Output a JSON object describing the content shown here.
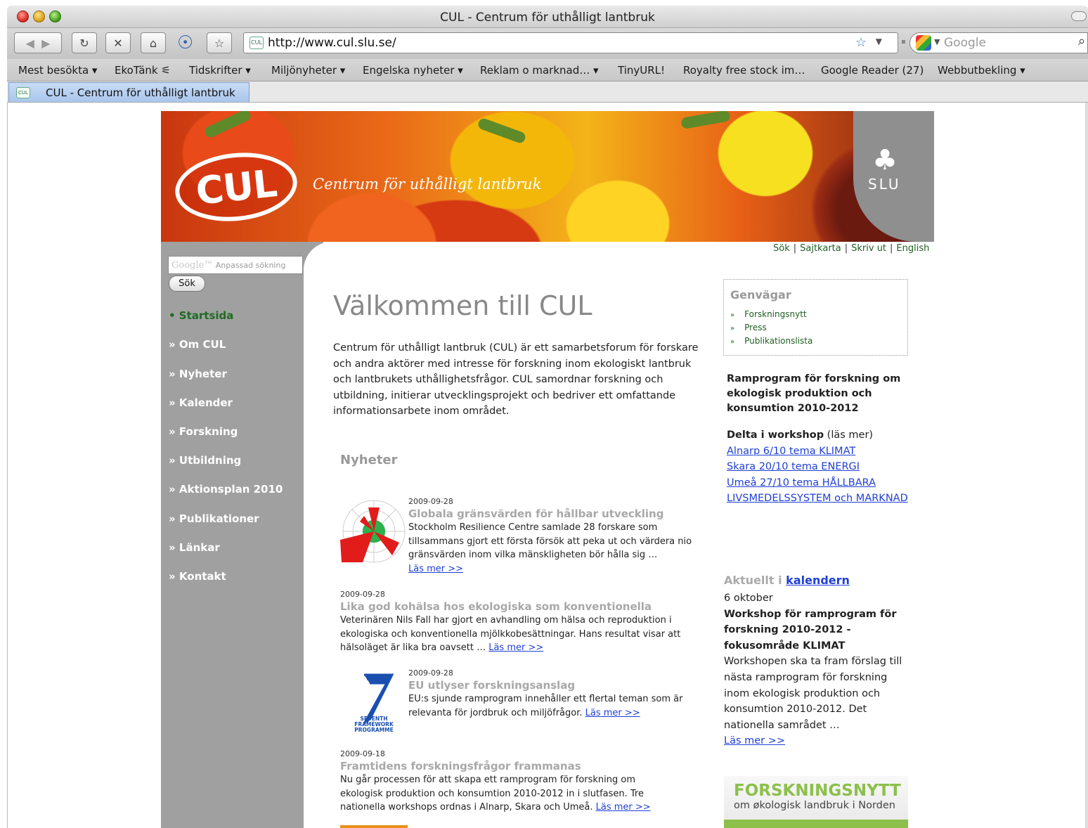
{
  "browser": {
    "window_title": "CUL - Centrum för uthålligt lantbruk",
    "url": "http://www.cul.slu.se/",
    "search_placeholder": "Google",
    "favicon_text": "CUL",
    "bookmarks": [
      "Mest besökta ▾",
      "EkoTänk ⚟",
      "Tidskrifter ▾",
      "Miljönyheter ▾",
      "Engelska nyheter ▾",
      "Reklam o marknad… ▾",
      "TinyURL!",
      "Royalty free stock im…",
      "Google Reader (27)",
      "Webbutbekling ▾"
    ],
    "tab_label": "CUL - Centrum för uthålligt lantbruk"
  },
  "banner": {
    "logo_text": "CUL",
    "tagline": "Centrum för uthålligt lantbruk",
    "slu_text": "SLU"
  },
  "toplinks": [
    "Sök",
    "Sajtkarta",
    "Skriv ut",
    "English"
  ],
  "sidebar": {
    "search_placeholder_brand": "Google™",
    "search_placeholder": "Anpassad sökning",
    "search_button": "Sök",
    "nav": [
      "• Startsida",
      "» Om CUL",
      "» Nyheter",
      "» Kalender",
      "» Forskning",
      "» Utbildning",
      "» Aktionsplan 2010",
      "» Publikationer",
      "» Länkar",
      "» Kontakt"
    ]
  },
  "main": {
    "heading": "Välkommen till CUL",
    "intro": "Centrum för uthålligt lantbruk (CUL) är ett samarbetsforum för forskare och andra aktörer med intresse för forskning inom ekologiskt lantbruk och lantbrukets uthållighetsfrågor. CUL samordnar forskning och utbildning, initierar utvecklingsprojekt och bedriver ett omfattande informationsarbete inom området.",
    "news_heading": "Nyheter",
    "read_more": "Läs mer >>",
    "news": [
      {
        "date": "2009-09-28",
        "title": "Globala gränsvärden för hållbar utveckling",
        "body": "Stockholm Resilience Centre samlade 28 forskare som tillsammans gjort ett första försök att peka ut och värdera nio gränsvärden inom vilka mänskligheten bör hålla sig …"
      },
      {
        "date": "2009-09-28",
        "title": "Lika god kohälsa hos ekologiska som konventionella",
        "body": "Veterinären Nils Fall har gjort en avhandling om hälsa och reproduktion i ekologiska och konventionella mjölkkobesättningar. Hans resultat visar att hälsoläget är lika bra oavsett …"
      },
      {
        "date": "2009-09-28",
        "title": "EU utlyser forskningsanslag",
        "body": "EU:s sjunde ramprogram innehåller ett flertal teman som är relevanta för jordbruk och miljöfrågor.",
        "logo_text": "SEVENTH FRAMEWORK PROGRAMME"
      },
      {
        "date": "2009-09-18",
        "title": "Framtidens forskningsfrågor frammanas",
        "body": "Nu går processen för att skapa ett ramprogram för forskning om ekologisk produktion och konsumtion 2010-2012 in i slutfasen. Tre nationella workshops ordnas i Alnarp, Skara och Umeå."
      }
    ]
  },
  "right": {
    "genvagar_title": "Genvägar",
    "genvagar": [
      "Forskningsnytt",
      "Press",
      "Publikationslista"
    ],
    "ramprogram": "Ramprogram för forskning om ekologisk produktion och konsumtion 2010-2012",
    "delta_bold": "Delta i workshop",
    "delta_rest": " (läs mer)",
    "workshops": [
      "Alnarp 6/10 tema KLIMAT",
      "Skara 20/10 tema ENERGI",
      "Umeå 27/10 tema HÅLLBARA LIVSMEDELSSYSTEM och MARKNAD"
    ],
    "aktuellt_prefix": "Aktuellt i",
    "aktuellt_link": "kalendern",
    "cal_date": "6 oktober",
    "cal_title": "Workshop för ramprogram för forskning 2010-2012 - fokusområde KLIMAT",
    "cal_body": "Workshopen ska ta fram förslag till nästa ramprogram för forskning inom ekologisk produktion och konsumtion 2010-2012. Det nationella samrådet …",
    "cal_more": "Läs mer >>",
    "fnytt_title": "FORSKNINGSNYTT",
    "fnytt_sub": "om økologisk landbruk i Norden"
  }
}
